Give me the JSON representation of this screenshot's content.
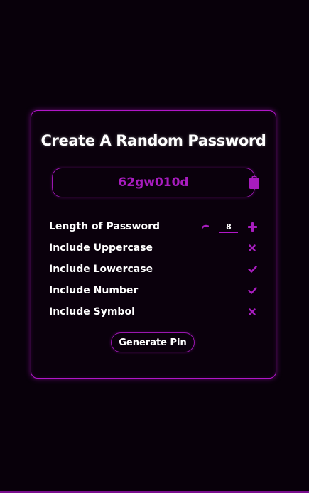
{
  "card": {
    "title": "Create A Random Password"
  },
  "password": {
    "value": "62gw010d"
  },
  "options": [
    {
      "label": "Length of Password",
      "value": "8"
    },
    {
      "label": "Include Uppercase",
      "state": "off",
      "icon": "cross-icon"
    },
    {
      "label": "Include Lowercase",
      "state": "on",
      "icon": "check-icon"
    },
    {
      "label": "Include Number",
      "state": "on",
      "icon": "check-icon"
    },
    {
      "label": "Include Symbol",
      "state": "off",
      "icon": "cross-icon"
    }
  ],
  "actions": {
    "generate_label": "Generate Pin"
  },
  "colors": {
    "background": "#08000a",
    "accent": "#b116c8",
    "password_text": "#a81cbf",
    "text": "#ffffff"
  }
}
